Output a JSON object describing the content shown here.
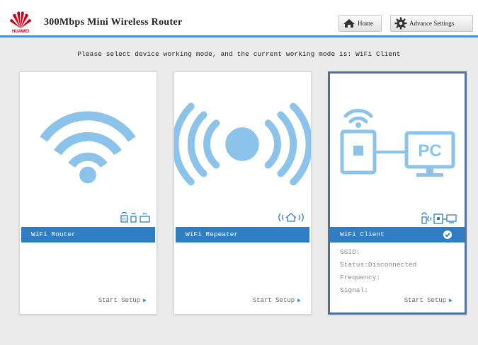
{
  "brand": {
    "logo_text": "HUAWEI",
    "color": "#d0011b"
  },
  "header": {
    "title": "300Mbps Mini Wireless Router",
    "home_label": "Home",
    "advance_label": "Advance Settings"
  },
  "prompt": "Please select device working mode, and the current working mode is: WiFi Client",
  "accent_color": "#2f7ec4",
  "icon_color": "#8cc3ea",
  "cards": {
    "router": {
      "label": "WiFi Router",
      "setup": "Start Setup"
    },
    "repeater": {
      "label": "WiFi Repeater",
      "setup": "Start Setup"
    },
    "client": {
      "label": "WiFi Client",
      "selected": true,
      "ssid": "SSID:",
      "status": "Status:Disconnected",
      "frequency": "Frequency:",
      "signal": "Signal:",
      "setup": "Start Setup",
      "pc_label": "PC"
    }
  }
}
